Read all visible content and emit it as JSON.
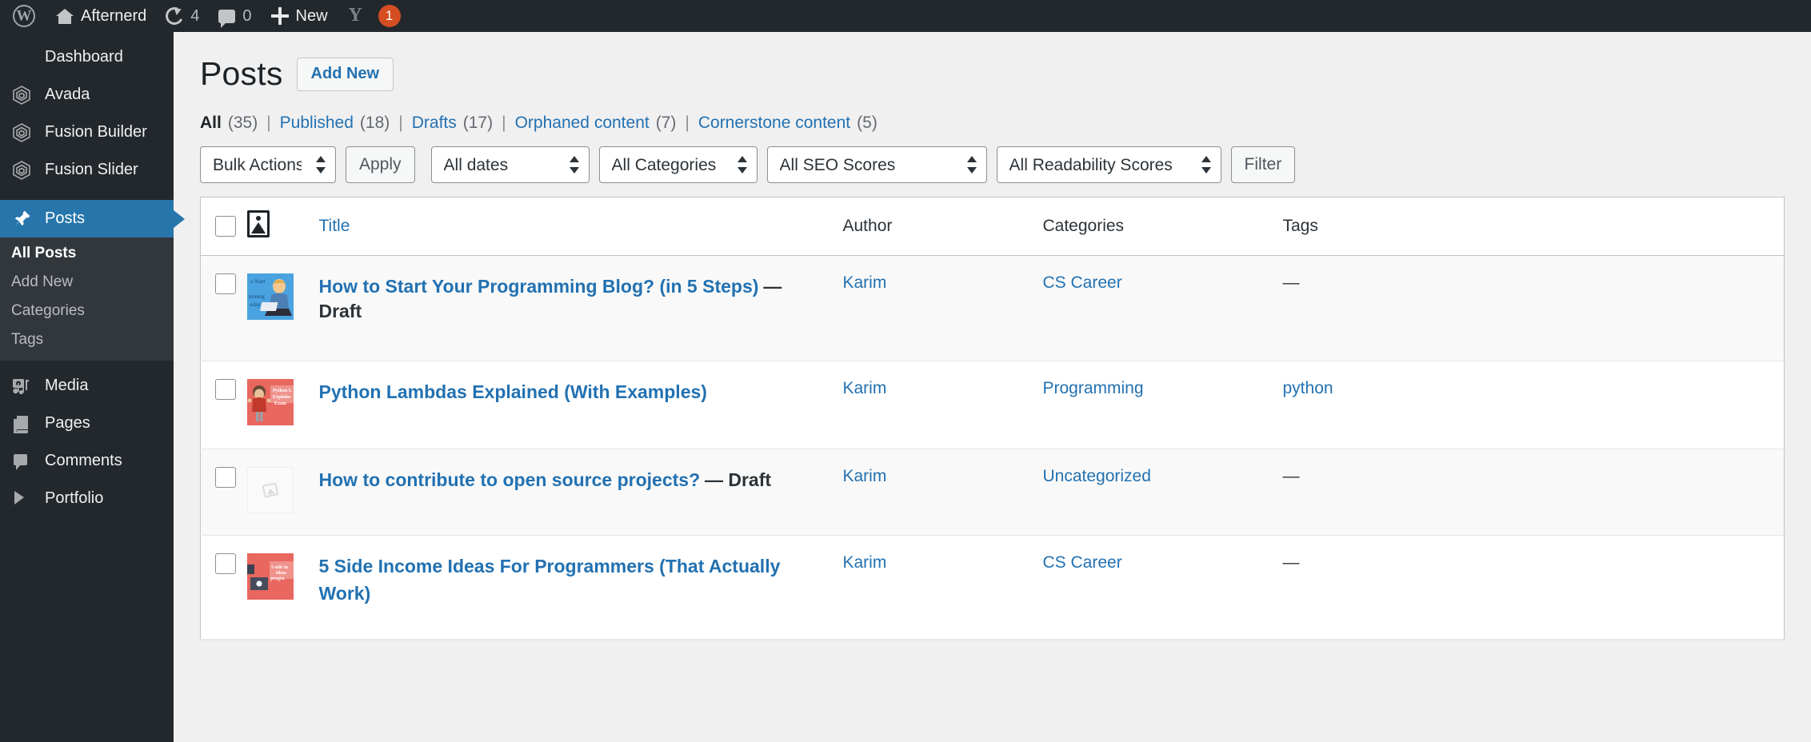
{
  "adminbar": {
    "wp_logo": "wordpress-logo",
    "site_name": "Afternerd",
    "updates_count": "4",
    "comments_count": "0",
    "new_label": "New",
    "yoast_glyph": "Y",
    "yoast_badge": "1"
  },
  "sidebar": {
    "items": [
      {
        "label": "Dashboard",
        "icon": "gauge-icon",
        "current": false
      },
      {
        "label": "Avada",
        "icon": "hexagon-icon",
        "current": false
      },
      {
        "label": "Fusion Builder",
        "icon": "hexagon-icon",
        "current": false
      },
      {
        "label": "Fusion Slider",
        "icon": "hexagon-icon",
        "current": false
      },
      {
        "label": "Posts",
        "icon": "pin-icon",
        "current": true
      },
      {
        "label": "Media",
        "icon": "media-icon",
        "current": false
      },
      {
        "label": "Pages",
        "icon": "pages-icon",
        "current": false
      },
      {
        "label": "Comments",
        "icon": "comments-icon",
        "current": false
      },
      {
        "label": "Portfolio",
        "icon": "portfolio-icon",
        "current": false
      }
    ],
    "submenu": [
      {
        "label": "All Posts",
        "current": true
      },
      {
        "label": "Add New",
        "current": false
      },
      {
        "label": "Categories",
        "current": false
      },
      {
        "label": "Tags",
        "current": false
      }
    ]
  },
  "header": {
    "title": "Posts",
    "add_new_label": "Add New"
  },
  "views": [
    {
      "label": "All",
      "count": "(35)",
      "current": true
    },
    {
      "label": "Published",
      "count": "(18)",
      "current": false
    },
    {
      "label": "Drafts",
      "count": "(17)",
      "current": false
    },
    {
      "label": "Orphaned content",
      "count": "(7)",
      "current": false
    },
    {
      "label": "Cornerstone content",
      "count": "(5)",
      "current": false
    }
  ],
  "tablenav": {
    "bulk_actions": "Bulk Actions",
    "apply_label": "Apply",
    "dates": "All dates",
    "categories": "All Categories",
    "seo_scores": "All SEO Scores",
    "readability_scores": "All Readability Scores",
    "filter_label": "Filter"
  },
  "table": {
    "columns": {
      "thumb": "featured-image-icon",
      "title": "Title",
      "author": "Author",
      "categories": "Categories",
      "tags": "Tags"
    },
    "rows": [
      {
        "title": "How to Start Your Programming Blog? (in 5 Steps)",
        "state": "— Draft",
        "author": "Karim",
        "categories": "CS Career",
        "tags": "—",
        "thumb": "blog-illustration-blue"
      },
      {
        "title": "Python Lambdas Explained (With Examples)",
        "state": "",
        "author": "Karim",
        "categories": "Programming",
        "tags": "python",
        "thumb": "python-lambdas-red"
      },
      {
        "title": "How to contribute to open source projects?",
        "state": "— Draft",
        "author": "Karim",
        "categories": "Uncategorized",
        "tags": "—",
        "thumb": "placeholder-empty"
      },
      {
        "title": "5 Side Income Ideas For Programmers (That Actually Work)",
        "state": "",
        "author": "Karim",
        "categories": "CS Career",
        "tags": "—",
        "thumb": "side-income-red"
      }
    ]
  },
  "colors": {
    "admin_bar": "#23282d",
    "menu_bg": "#23282d",
    "menu_current": "#2776ab",
    "link": "#2271b1",
    "badge": "#d54e21",
    "content_bg": "#f0f0f1"
  }
}
